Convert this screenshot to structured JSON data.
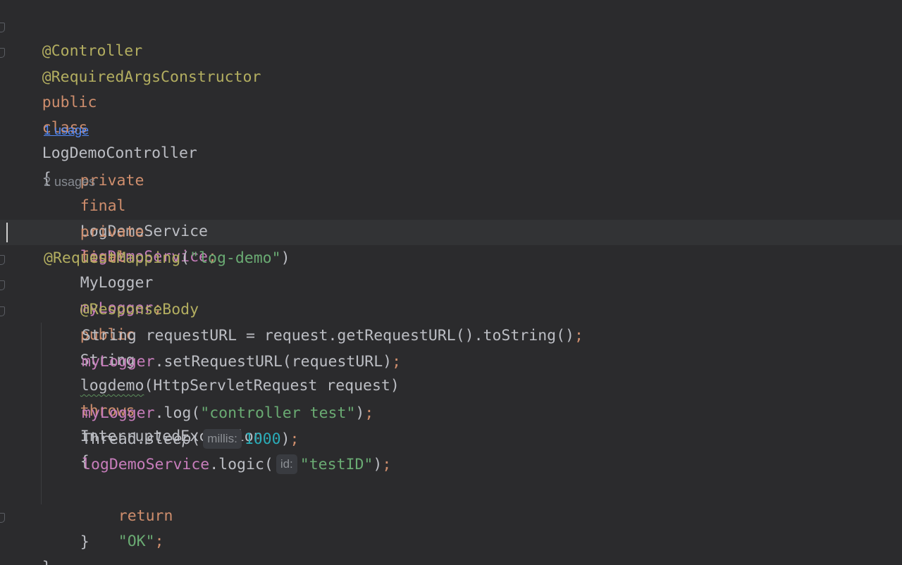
{
  "editor": {
    "usage_hints": {
      "log_demo_service": "1 usage",
      "my_logger": "2 usages"
    },
    "inlay_hints": {
      "millis": "millis:",
      "id": "id:"
    },
    "lines": {
      "l1": {
        "annotation": "@Controller"
      },
      "l2": {
        "annotation": "@RequiredArgsConstructor"
      },
      "l3": {
        "kw_public": "public",
        "kw_class": "class",
        "class_name": "LogDemoController",
        "brace": "{"
      },
      "l5": {
        "kw_private": "private",
        "kw_final": "final",
        "type": "LogDemoService",
        "field": "logDemoService",
        "semi": ";"
      },
      "l7": {
        "kw_private": "private",
        "kw_final": "final",
        "type": "MyLogger",
        "field": "myLogger",
        "semi": ";"
      },
      "l9": {
        "annotation": "@RequestMapping",
        "open": "(",
        "string": "\"log-demo\"",
        "close": ")"
      },
      "l10": {
        "annotation": "@ResponseBody"
      },
      "l11": {
        "kw_public": "public",
        "type": "String",
        "method": "logdemo",
        "params": "(HttpServletRequest request)",
        "kw_throws": "throws",
        "exception": "InterruptedException",
        "brace": "{"
      },
      "l12": {
        "code": "String requestURL = request.getRequestURL().toString()",
        "semi": ";"
      },
      "l13": {
        "field": "myLogger",
        "code": ".setRequestURL(requestURL)",
        "semi": ";"
      },
      "l15": {
        "field": "myLogger",
        "code_open": ".log(",
        "string": "\"controller test\"",
        "code_close": ")",
        "semi": ";"
      },
      "l16": {
        "class_name": "Thread.",
        "method": "sleep",
        "open": "(",
        "number": "1000",
        "close": ")",
        "semi": ";"
      },
      "l17": {
        "field": "logDemoService",
        "code_open": ".logic(",
        "string": "\"testID\"",
        "close": ")",
        "semi": ";"
      },
      "l18": {
        "kw_return": "return",
        "string": "\"OK\"",
        "semi": ";"
      },
      "l19": {
        "brace": "}"
      },
      "l20": {
        "brace": "}"
      }
    }
  }
}
